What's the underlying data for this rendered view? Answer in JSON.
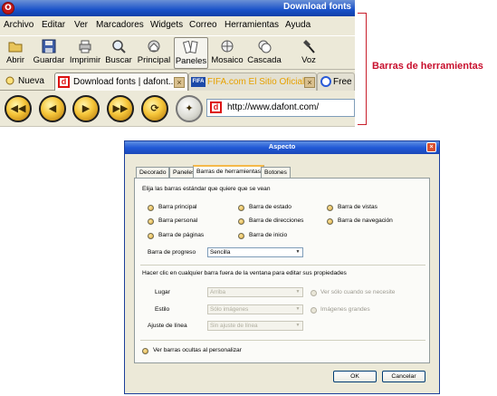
{
  "browser": {
    "window_title": "Download fonts",
    "app_logo_letter": "O",
    "menu": [
      "Archivo",
      "Editar",
      "Ver",
      "Marcadores",
      "Widgets",
      "Correo",
      "Herramientas",
      "Ayuda"
    ],
    "toolbar": [
      "Abrir",
      "Guardar",
      "Imprimir",
      "Buscar",
      "Principal",
      "Paneles",
      "Mosaico",
      "Cascada",
      "Voz"
    ],
    "tabs": {
      "new_tab": "Nueva",
      "tab1": "Download fonts | dafont...",
      "tab2_badge": "FIFA",
      "tab2": "FIFA.com El Sitio Oficial ...",
      "tab3": "Free"
    },
    "nav": {
      "favicon_letter": "d",
      "url": "http://www.dafont.com/"
    }
  },
  "annotation": {
    "label": "Barras de herramientas"
  },
  "dialog": {
    "title": "Aspecto",
    "tabs": [
      "Decorado",
      "Paneles",
      "Barras de herramientas",
      "Botones"
    ],
    "intro": "Elija las barras estándar que quiere que se vean",
    "bars": [
      "Barra principal",
      "Barra de estado",
      "Barra de vistas",
      "Barra personal",
      "Barra de direcciones",
      "Barra de navegación",
      "Barra de páginas",
      "Barra de inicio"
    ],
    "progress_label": "Barra de progreso",
    "progress_value": "Sencilla",
    "click_hint": "Hacer clic en cualquier barra fuera de la ventana para editar sus propiedades",
    "place_label": "Lugar",
    "place_value": "Arriba",
    "style_label": "Estilo",
    "style_value": "Sólo imágenes",
    "wrap_label": "Ajuste de línea",
    "wrap_value": "Sin ajuste de línea",
    "opt_only_needed": "Ver sólo cuando se necesite",
    "opt_big_images": "Imágenes grandes",
    "show_hidden": "Ver barras ocultas al personalizar",
    "ok": "OK",
    "cancel": "Cancelar"
  },
  "colors": {
    "annotation": "#c8102e",
    "title_bar": "#2259d6",
    "radio": "#e2b552"
  },
  "icons": [
    "folder-icon",
    "floppy-icon",
    "printer-icon",
    "magnifier-icon",
    "home-icon",
    "panels-icon",
    "tile-icon",
    "cascade-icon",
    "voice-icon",
    "rewind-icon",
    "back-icon",
    "forward-icon",
    "fast-forward-icon",
    "reload-icon",
    "wand-icon"
  ]
}
